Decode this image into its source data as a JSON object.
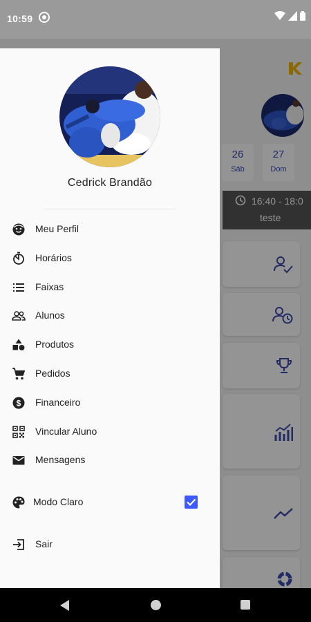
{
  "status_bar": {
    "time": "10:59"
  },
  "background": {
    "days": [
      {
        "num": "26",
        "label": "Sáb"
      },
      {
        "num": "27",
        "label": "Dom"
      }
    ],
    "class_time": "16:40 - 18:0",
    "class_name": "teste",
    "accent_color": "#3949ab"
  },
  "drawer": {
    "user_name": "Cedrick Brandão",
    "menu": [
      {
        "label": "Meu Perfil",
        "icon": "face-icon"
      },
      {
        "label": "Horários",
        "icon": "timer-icon"
      },
      {
        "label": "Faixas",
        "icon": "list-icon"
      },
      {
        "label": "Alunos",
        "icon": "people-icon"
      },
      {
        "label": "Produtos",
        "icon": "category-icon"
      },
      {
        "label": "Pedidos",
        "icon": "cart-icon"
      },
      {
        "label": "Financeiro",
        "icon": "dollar-icon"
      },
      {
        "label": "Vincular Aluno",
        "icon": "qr-code-icon"
      },
      {
        "label": "Mensagens",
        "icon": "mail-icon"
      }
    ],
    "theme_toggle": {
      "label": "Modo Claro",
      "checked": true,
      "icon": "palette-icon"
    },
    "logout": {
      "label": "Sair",
      "icon": "logout-icon"
    }
  }
}
